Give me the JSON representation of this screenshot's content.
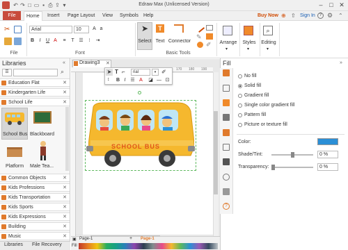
{
  "app": {
    "title": "Edraw Max (Unlicensed Version)"
  },
  "menu": {
    "file": "File",
    "items": [
      {
        "label": "Home"
      },
      {
        "label": "Insert"
      },
      {
        "label": "Page Layout"
      },
      {
        "label": "View"
      },
      {
        "label": "Symbols"
      },
      {
        "label": "Help"
      }
    ],
    "buy_now": "Buy Now",
    "sign_in": "Sign In"
  },
  "ribbon": {
    "font_name": "Arial",
    "font_size": "10",
    "group_file": "File",
    "group_font": "Font",
    "group_basic_tools": "Basic Tools",
    "select": "Select",
    "text": "Text",
    "connector": "Connector",
    "arrange": "Arrange",
    "styles": "Styles",
    "editing": "Editing"
  },
  "libraries": {
    "title": "Libraries",
    "top_items": [
      "Education Flat",
      "Kindergarten Life",
      "School Life"
    ],
    "shapes": [
      {
        "label": "School Bus"
      },
      {
        "label": "Blackboard"
      },
      {
        "label": "Platform"
      },
      {
        "label": "Male Tea..."
      }
    ],
    "bottom_items": [
      "Common Objects",
      "Kids Professions",
      "Kids Transportation",
      "Kids Sports",
      "Kids Expressions",
      "Building",
      "Music"
    ],
    "tab_libraries": "Libraries",
    "tab_file_recovery": "File Recovery"
  },
  "document": {
    "tab": "Drawing3",
    "floating_font": "rial",
    "bus_text": "SCHOOL BUS",
    "ruler_marks": [
      "170",
      "180",
      "190"
    ]
  },
  "fill": {
    "title": "Fill",
    "options": [
      {
        "label": "No fill",
        "selected": false
      },
      {
        "label": "Solid fill",
        "selected": true
      },
      {
        "label": "Gradient fill",
        "selected": false
      },
      {
        "label": "Single color gradient fill",
        "selected": false
      },
      {
        "label": "Pattern fill",
        "selected": false
      },
      {
        "label": "Picture or texture fill",
        "selected": false
      }
    ],
    "color_label": "Color:",
    "color_value": "#2b8fd6",
    "shade_label": "Shade/Tint:",
    "shade_value": "0 %",
    "transparency_label": "Transparency:",
    "transparency_value": "0 %"
  },
  "status": {
    "page_select": "Page-1",
    "page_tab": "Page-1",
    "fill_label": "Fill"
  },
  "colors": {
    "accent": "#c84b3c",
    "bus_yellow": "#f5b82e",
    "fill_blue": "#2b8fd6"
  }
}
